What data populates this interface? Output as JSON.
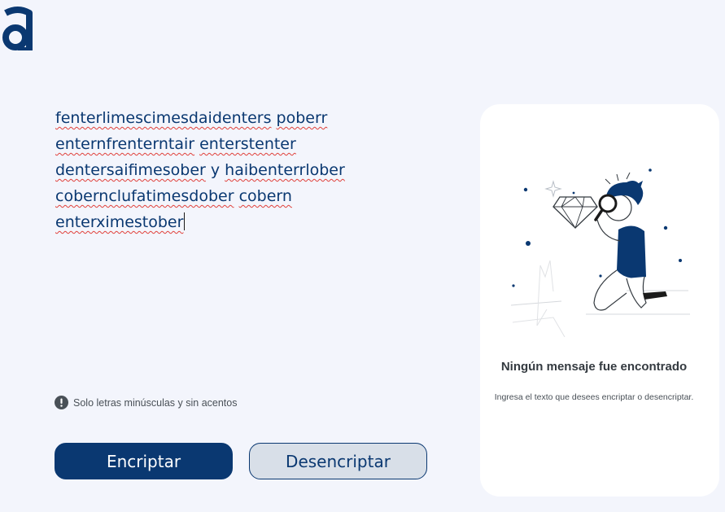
{
  "app": {
    "logo_icon": "alura-a-logo-icon",
    "accent_color": "#0a3871"
  },
  "editor": {
    "lines": [
      [
        {
          "text": "fenterlimescimesdaidenters",
          "spell": true
        },
        {
          "text": " ",
          "spell": false
        },
        {
          "text": "poberr",
          "spell": true
        }
      ],
      [
        {
          "text": "enternfrenterntair",
          "spell": true
        },
        {
          "text": " ",
          "spell": false
        },
        {
          "text": "enterstenter",
          "spell": true
        }
      ],
      [
        {
          "text": "dentersaifimesober",
          "spell": true
        },
        {
          "text": " y ",
          "spell": false
        },
        {
          "text": "haibenterrlober",
          "spell": true
        }
      ],
      [
        {
          "text": "cobernclufatimesdober",
          "spell": true
        },
        {
          "text": " ",
          "spell": false
        },
        {
          "text": "cobern",
          "spell": true
        }
      ],
      [
        {
          "text": "enterximestober",
          "spell": true
        }
      ]
    ]
  },
  "hint": {
    "icon": "exclamation-circle-icon",
    "text": "Solo letras minúsculas y sin acentos"
  },
  "buttons": {
    "encrypt_label": "Encriptar",
    "decrypt_label": "Desencriptar"
  },
  "output_panel": {
    "illustration": "person-with-magnifying-glass-diamond-illustration",
    "title": "Ningún mensaje fue encontrado",
    "subtitle": "Ingresa el texto que desees encriptar o desencriptar."
  }
}
